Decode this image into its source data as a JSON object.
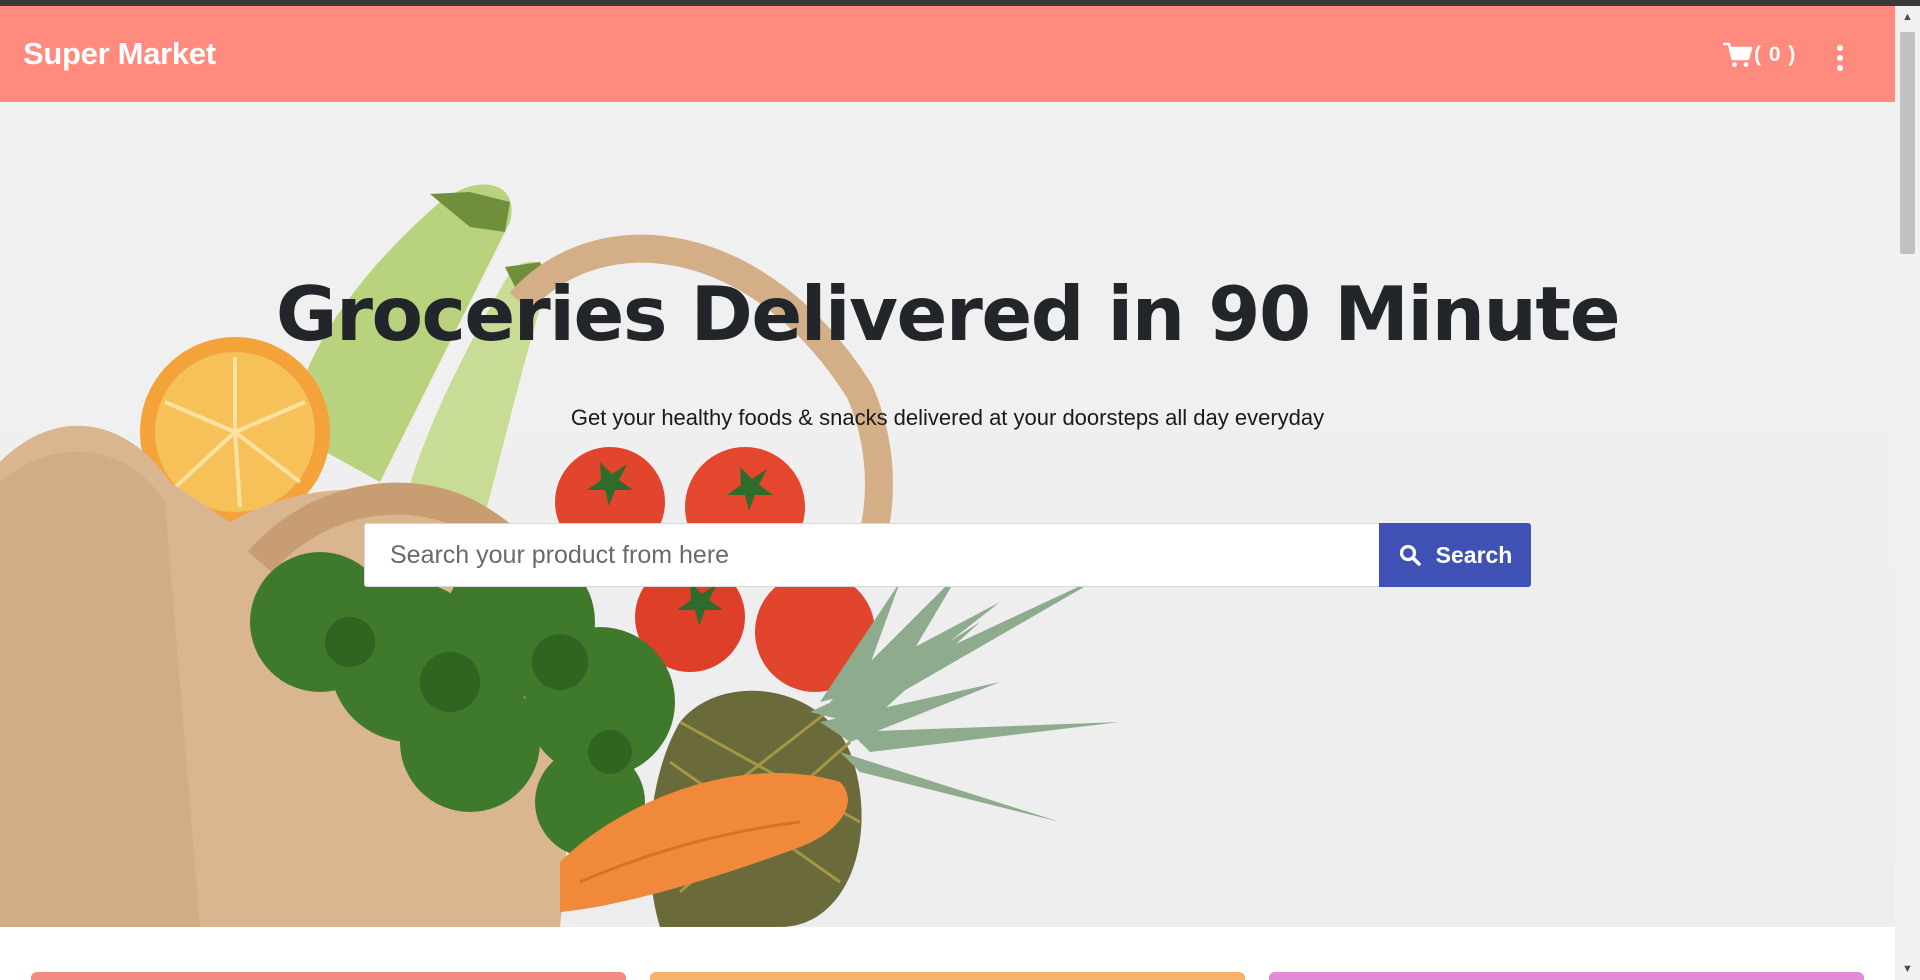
{
  "header": {
    "brand": "Super Market",
    "cart_count": "( 0 )"
  },
  "hero": {
    "title": "Groceries Delivered in 90 Minute",
    "subtitle": "Get your healthy foods & snacks delivered at your doorsteps all day everyday"
  },
  "search": {
    "placeholder": "Search your product from here",
    "button_label": "Search"
  },
  "colors": {
    "navbar": "#ff8a7d",
    "search_button": "#3f51b5",
    "card_1": "#f28b82",
    "card_2": "#f6b26b",
    "card_3": "#e48bd8"
  },
  "icons": {
    "cart": "cart-icon",
    "menu": "more-vertical-icon",
    "search": "search-icon"
  }
}
